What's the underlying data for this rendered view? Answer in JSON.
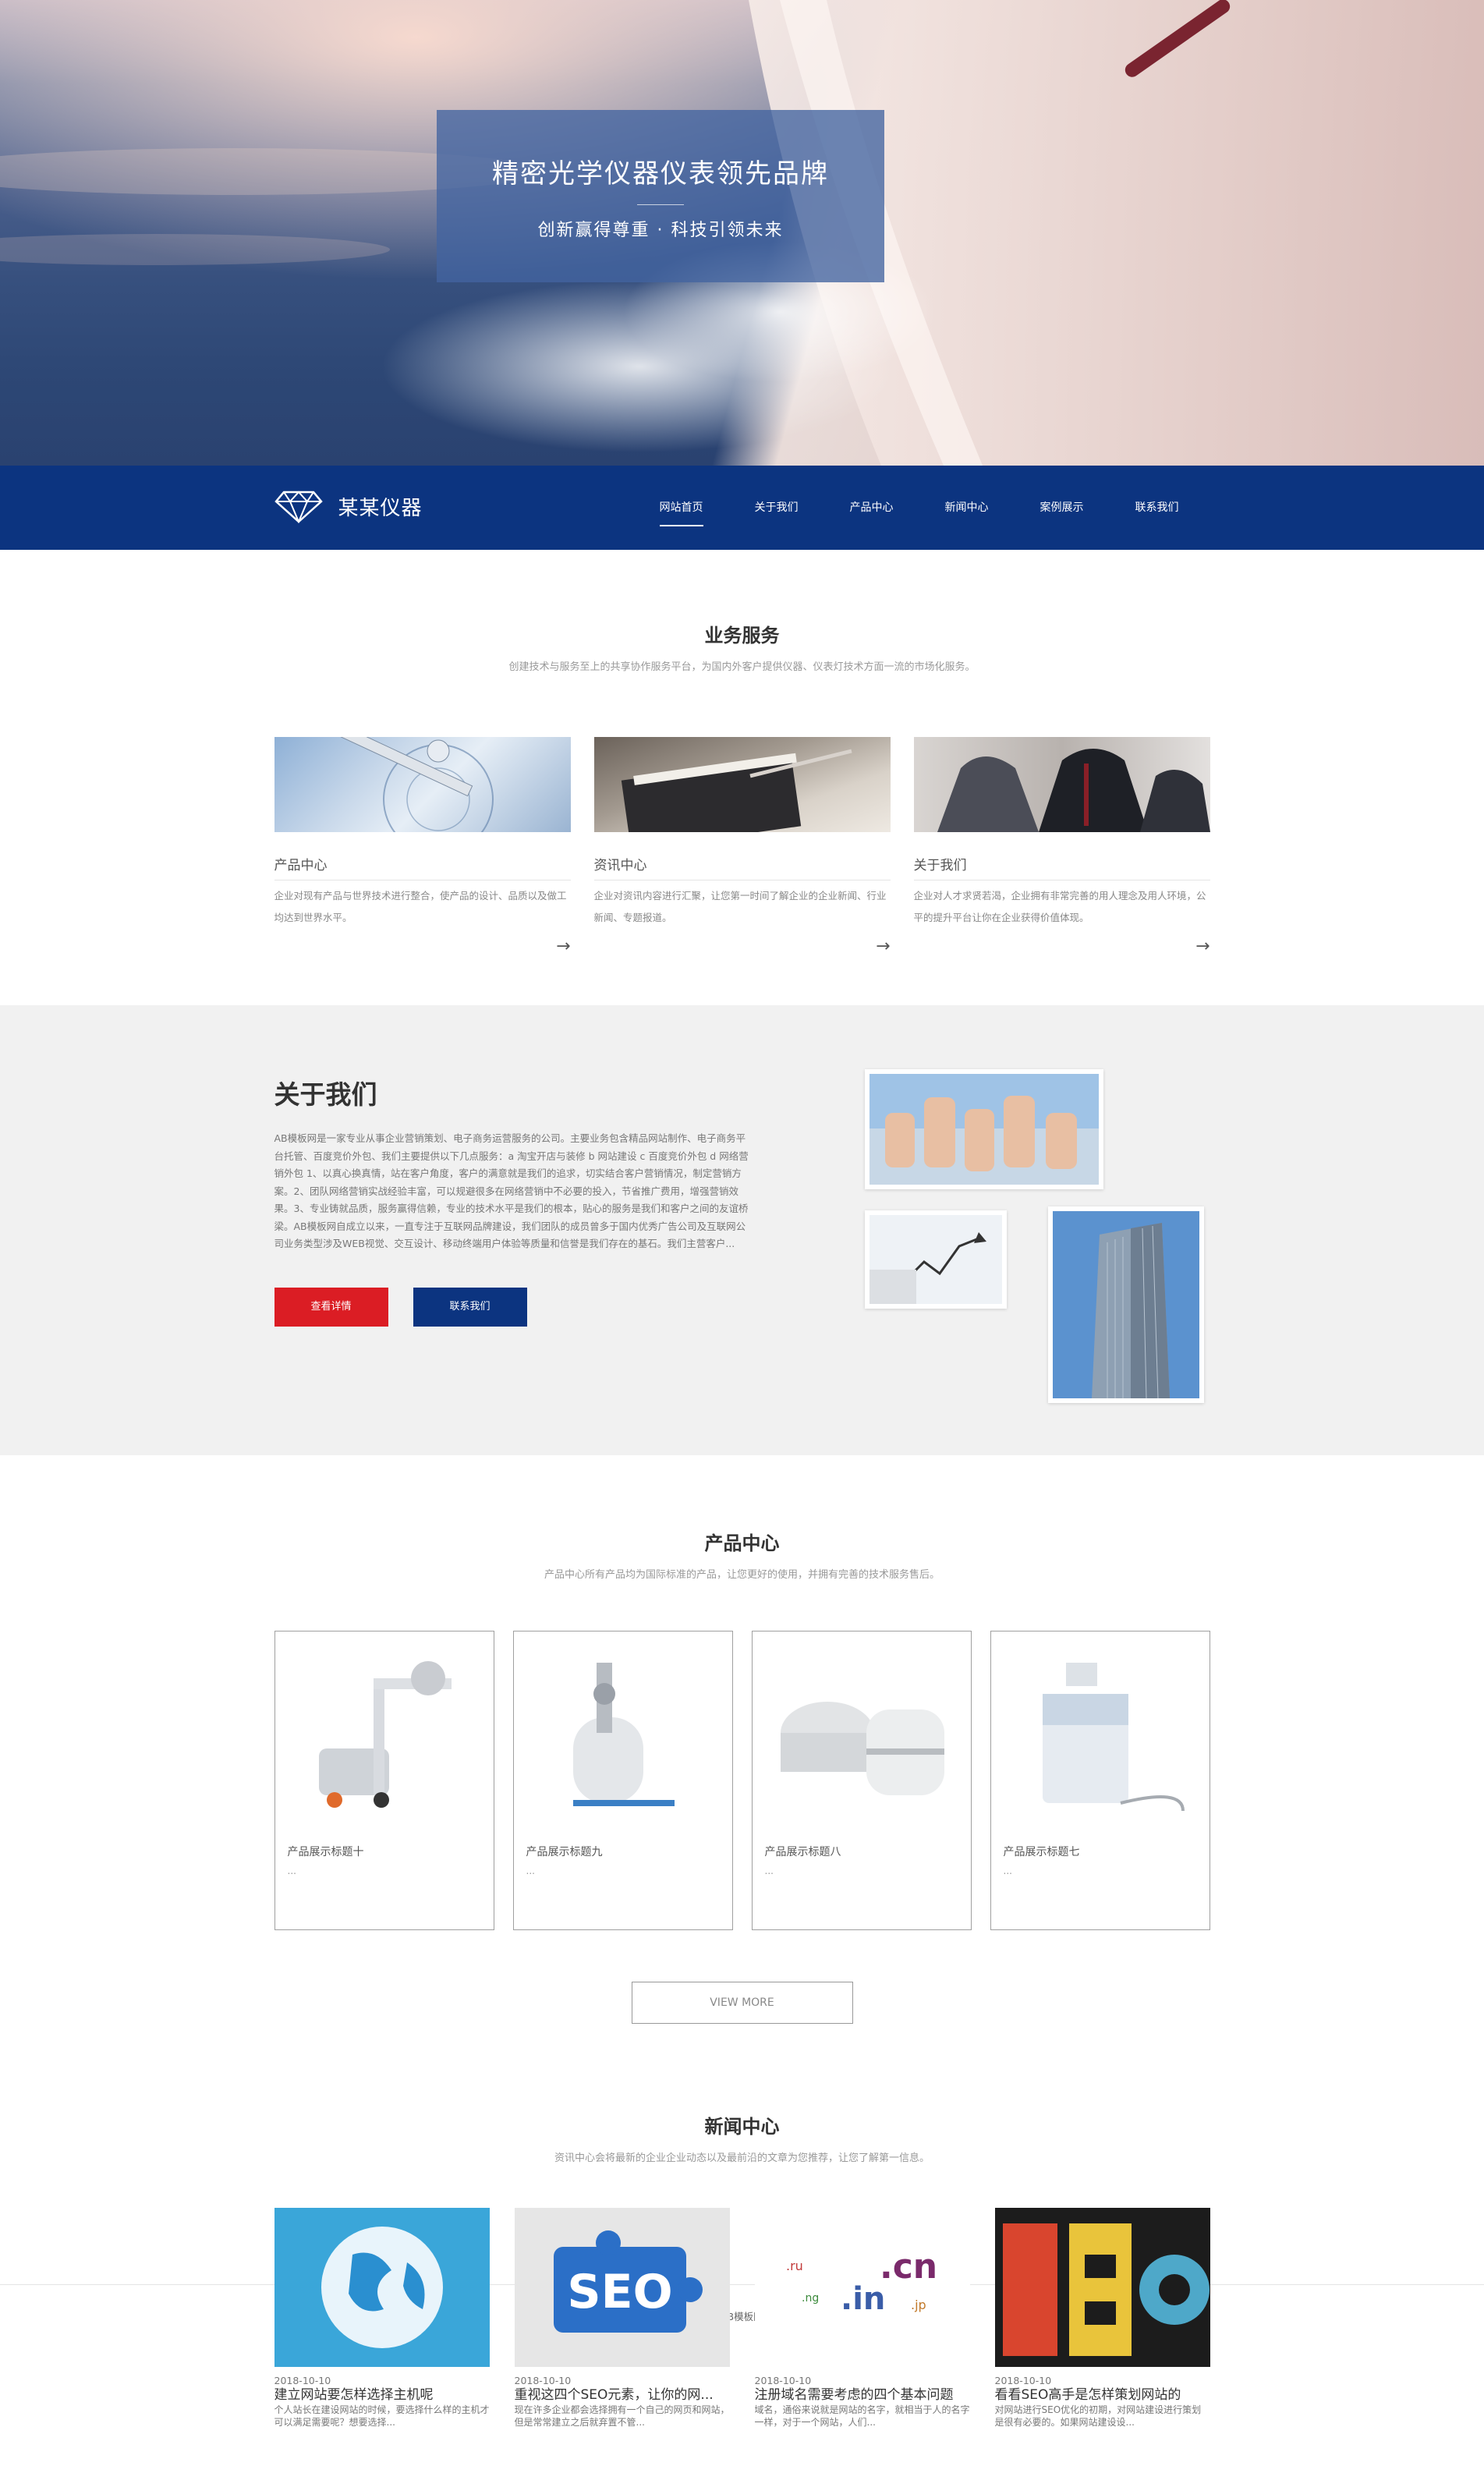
{
  "hero": {
    "title": "精密光学仪器仪表领先品牌",
    "subtitle": "创新赢得尊重 · 科技引领未来"
  },
  "nav": {
    "logo_text": "某某仪器",
    "logo_icon": "diamond-icon",
    "items": [
      "网站首页",
      "关于我们",
      "产品中心",
      "新闻中心",
      "案例展示",
      "联系我们"
    ],
    "active_index": 0
  },
  "services": {
    "title": "业务服务",
    "desc": "创建技术与服务至上的共享协作服务平台，为国内外客户提供仪器、仪表灯技术方面一流的市场化服务。",
    "items": [
      {
        "title": "产品中心",
        "text": "企业对现有产品与世界技术进行整合，使产品的设计、品质以及做工均达到世界水平。",
        "arrow": "→"
      },
      {
        "title": "资讯中心",
        "text": "企业对资讯内容进行汇聚，让您第一时间了解企业的企业新闻、行业新闻、专题报道。",
        "arrow": "→"
      },
      {
        "title": "关于我们",
        "text": "企业对人才求贤若渴，企业拥有非常完善的用人理念及用人环境，公平的提升平台让你在企业获得价值体现。",
        "arrow": "→"
      }
    ]
  },
  "about": {
    "title": "关于我们",
    "text": "AB模板网是一家专业从事企业营销策划、电子商务运营服务的公司。主要业务包含精品网站制作、电子商务平台托管、百度竞价外包、我们主要提供以下几点服务：a 淘宝开店与装修 b 网站建设 c 百度竞价外包 d 网络营销外包 1、以真心换真情，站在客户角度，客户的满意就是我们的追求，切实结合客户营销情况，制定营销方案。2、团队网络营销实战经验丰富，可以规避很多在网络营销中不必要的投入，节省推广费用，增强营销效果。3、专业铸就品质，服务赢得信赖，专业的技术水平是我们的根本，贴心的服务是我们和客户之间的友谊桥梁。AB模板网自成立以来，一直专注于互联网品牌建设，我们团队的成员曾多于国内优秀广告公司及互联网公司业务类型涉及WEB视觉、交互设计、移动终端用户体验等质量和信誉是我们存在的基石。我们主营客户...",
    "btn_detail": "查看详情",
    "btn_contact": "联系我们"
  },
  "products": {
    "title": "产品中心",
    "desc": "产品中心所有产品均为国际标准的产品，让您更好的使用，并拥有完善的技术服务售后。",
    "items": [
      {
        "name": "产品展示标题十",
        "dots": "..."
      },
      {
        "name": "产品展示标题九",
        "dots": "..."
      },
      {
        "name": "产品展示标题八",
        "dots": "..."
      },
      {
        "name": "产品展示标题七",
        "dots": "..."
      }
    ],
    "view_more": "VIEW MORE"
  },
  "news": {
    "title": "新闻中心",
    "desc": "资讯中心会将最新的企业企业动态以及最前沿的文章为您推荐，让您了解第一信息。",
    "items": [
      {
        "date": "2018-10-10",
        "title": "建立网站要怎样选择主机呢",
        "text": "个人站长在建设网站的时候，要选择什么样的主机才可以满足需要呢？想要选择..."
      },
      {
        "date": "2018-10-10",
        "title": "重视这四个SEO元素，让你的网...",
        "text": "现在许多企业都会选择拥有一个自己的网页和网站，但是常常建立之后就弃置不管..."
      },
      {
        "date": "2018-10-10",
        "title": "注册域名需要考虑的四个基本问题",
        "text": "域名，通俗来说就是网站的名字，就相当于人的名字一样，对于一个网站，人们..."
      },
      {
        "date": "2018-10-10",
        "title": "看看SEO高手是怎样策划网站的",
        "text": "对网站进行SEO优化的初期，对网站建设进行策划是很有必要的。如果网站建设设..."
      }
    ]
  },
  "footer": {
    "copyright": "Copyright © 2002-2017 AB模板网 版权所有    苏ICP12345678"
  }
}
